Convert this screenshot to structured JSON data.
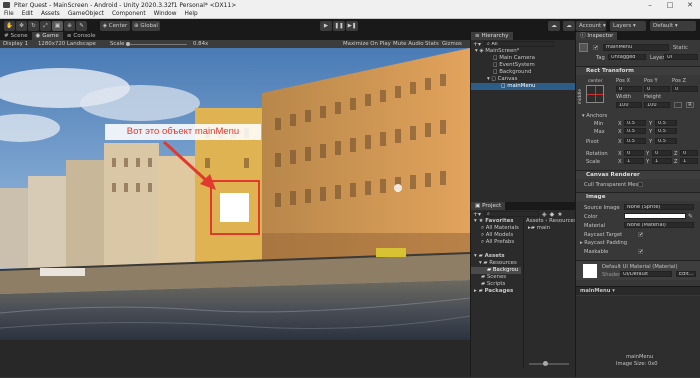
{
  "window": {
    "title": "Piter Quest - MainScreen - Android - Unity 2020.3.32f1 Personal* <DX11>"
  },
  "menu": [
    "File",
    "Edit",
    "Assets",
    "GameObject",
    "Component",
    "Window",
    "Help"
  ],
  "toolbar": {
    "center_label": "Center",
    "global_label": "Global",
    "account_label": "Account",
    "layers_label": "Layers",
    "layout_label": "Default"
  },
  "scene_tabs": {
    "scene": "Scene",
    "game": "Game",
    "console": "Console"
  },
  "gamebar": {
    "display": "Display 1",
    "resolution": "1280x720 Landscape",
    "scale_label": "Scale",
    "scale_value": "0.84x",
    "maximize": "Maximize On Play",
    "mute": "Mute Audio",
    "stats": "Stats",
    "gizmos": "Gizmos"
  },
  "annotation": {
    "text": "Вот это объект mainMenu",
    "color": "#e03a2f"
  },
  "hierarchy": {
    "title": "Hierarchy",
    "search_label": "All",
    "scene": "MainScreen*",
    "items": [
      "Main Camera",
      "EventSystem",
      "Background",
      "Canvas",
      "mainMenu"
    ]
  },
  "project": {
    "title": "Project",
    "favorites_label": "Favorites",
    "favorites": [
      "All Materials",
      "All Models",
      "All Prefabs"
    ],
    "assets_label": "Assets",
    "assets_children": [
      "Resources",
      "Backgrou",
      "Scenes",
      "Scripts"
    ],
    "packages_label": "Packages",
    "breadcrumb": [
      "Assets",
      "Resources"
    ],
    "file": "main"
  },
  "inspector": {
    "title": "Inspector",
    "object_name": "mainMenu",
    "static_label": "Static",
    "tag_label": "Tag",
    "tag_value": "Untagged",
    "layer_label": "Layer",
    "layer_value": "UI",
    "rect_transform": {
      "title": "Rect Transform",
      "anchor_h": "center",
      "anchor_v": "middle",
      "posx_label": "Pos X",
      "posy_label": "Pos Y",
      "posz_label": "Pos Z",
      "posx": "0",
      "posy": "0",
      "posz": "0",
      "width_label": "Width",
      "height_label": "Height",
      "width": "100",
      "height": "100",
      "anchors_label": "Anchors",
      "min_label": "Min",
      "max_label": "Max",
      "pivot_label": "Pivot",
      "min_x": "0.5",
      "min_y": "0.5",
      "max_x": "0.5",
      "max_y": "0.5",
      "pivot_x": "0.5",
      "pivot_y": "0.5",
      "rotation_label": "Rotation",
      "scale_label": "Scale",
      "rot_x": "0",
      "rot_y": "0",
      "rot_z": "0",
      "scale_x": "1",
      "scale_y": "1",
      "scale_z": "1"
    },
    "canvas_renderer": {
      "title": "Canvas Renderer",
      "cull_label": "Cull Transparent Mes"
    },
    "image": {
      "title": "Image",
      "source_label": "Source Image",
      "source_value": "None (Sprite)",
      "color_label": "Color",
      "material_label": "Material",
      "material_value": "None (Material)",
      "raycast_label": "Raycast Target",
      "padding_label": "Raycast Padding",
      "maskable_label": "Maskable"
    },
    "material_preview": {
      "name": "Default UI Material (Material)",
      "shader_label": "Shader",
      "shader_value": "UI/Default",
      "edit_label": "Edit..."
    },
    "footer_object": "mainMenu",
    "preview_name": "mainMenu",
    "image_size": "Image Size: 0x0"
  },
  "colors": {
    "selection": "#2c5d87",
    "accent": "#e03a2f"
  }
}
